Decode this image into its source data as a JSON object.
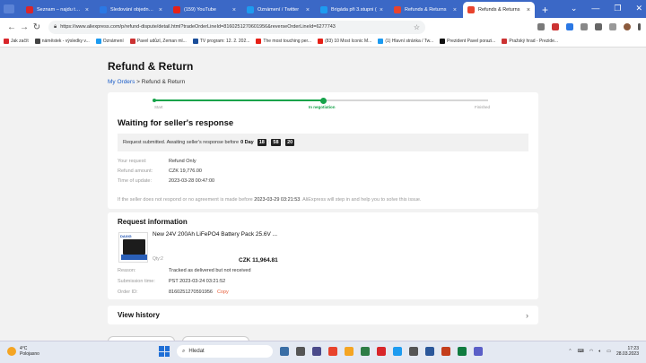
{
  "browser": {
    "tabs": [
      {
        "title": "Seznam – najdu tam, c",
        "color": "#d8262b",
        "active": false
      },
      {
        "title": "Sledování objednávky",
        "color": "#2b78e4",
        "active": false
      },
      {
        "title": "(159) YouTube",
        "color": "#e62117",
        "active": false
      },
      {
        "title": "Oznámení / Twitter",
        "color": "#1d9bf0",
        "active": false
      },
      {
        "title": "Brigáda při 3.stupni (",
        "color": "#1d9bf0",
        "active": false
      },
      {
        "title": "Refunds & Returns",
        "color": "#e8432d",
        "active": false
      },
      {
        "title": "Refunds & Returns",
        "color": "#e8432d",
        "active": true
      }
    ],
    "url": "https://www.aliexpress.com/p/refund-dispute/detail.html?tradeOrderLineId=8160251270601956&reverseOrderLineId=6277743",
    "bookmarks": [
      {
        "label": "Jak začít",
        "color": "#d8262b"
      },
      {
        "label": "náměstek - výsledky v...",
        "color": "#444"
      },
      {
        "label": "Oznámení",
        "color": "#1d9bf0"
      },
      {
        "label": "Pavel udůzl, Zeman ml...",
        "color": "#c33"
      },
      {
        "label": "TV program: 12. 2. 202...",
        "color": "#1b4e9a"
      },
      {
        "label": "The most touching per...",
        "color": "#e62117"
      },
      {
        "label": "(83) 10 Most Iconic M...",
        "color": "#e62117"
      },
      {
        "label": "(1) Hlavní stránka / Tw...",
        "color": "#1d9bf0"
      },
      {
        "label": "Prezident Pavel porazi...",
        "color": "#111"
      },
      {
        "label": "Pražský hrad - Prezide...",
        "color": "#c33"
      }
    ]
  },
  "page": {
    "title": "Refund & Return",
    "breadcrumb": {
      "link": "My Orders",
      "sep": ">",
      "current": "Refund & Return"
    },
    "progress": {
      "steps": [
        "Start",
        "In negotiation",
        "Finished"
      ],
      "current_step": 2
    },
    "status": {
      "heading": "Waiting for seller's response",
      "countdown_text": "Request submitted. Awaiting seller's response before",
      "days": "0 Day",
      "hours": "18",
      "minutes": "58",
      "seconds": "20"
    },
    "details": [
      {
        "key": "Your request:",
        "value": "Refund Only"
      },
      {
        "key": "Refund amount:",
        "value": "CZK 19,776.00"
      },
      {
        "key": "Time of update:",
        "value": "2023-03-28 00:47:00"
      }
    ],
    "note": {
      "before": "If the seller does not respond or no agreement is made before",
      "deadline": "2023-03-29 03:21:53",
      "after": ". AliExpress will step in and help you to solve this issue."
    },
    "request_info": {
      "title": "Request information",
      "product_name": "New 24V 200Ah LiFePO4 Battery Pack 25.6V ...",
      "brand_tag": "DAXIG",
      "qty": "Qty:2",
      "price": "CZK 11,964.81",
      "rows": [
        {
          "key": "Reason:",
          "value": "Tracked as delivered but not received"
        },
        {
          "key": "Submission time:",
          "value": "PST 2023-03-24 03:21:52"
        },
        {
          "key": "Order ID:",
          "value": "8160251270591956"
        }
      ],
      "copy_label": "Copy"
    },
    "view_history": "View history"
  },
  "taskbar": {
    "temp": "4°C",
    "weather": "Polojasno",
    "search_placeholder": "Hledat",
    "time": "17:23",
    "date": "28.03.2023",
    "icon_colors": [
      "#3a6ea5",
      "#555",
      "#4a4a8a",
      "#e8432d",
      "#f4a524",
      "#2d7d46",
      "#d8262b",
      "#1d9bf0",
      "#555",
      "#2b579a",
      "#c43e1c",
      "#107c41",
      "#5b5fc7"
    ]
  }
}
